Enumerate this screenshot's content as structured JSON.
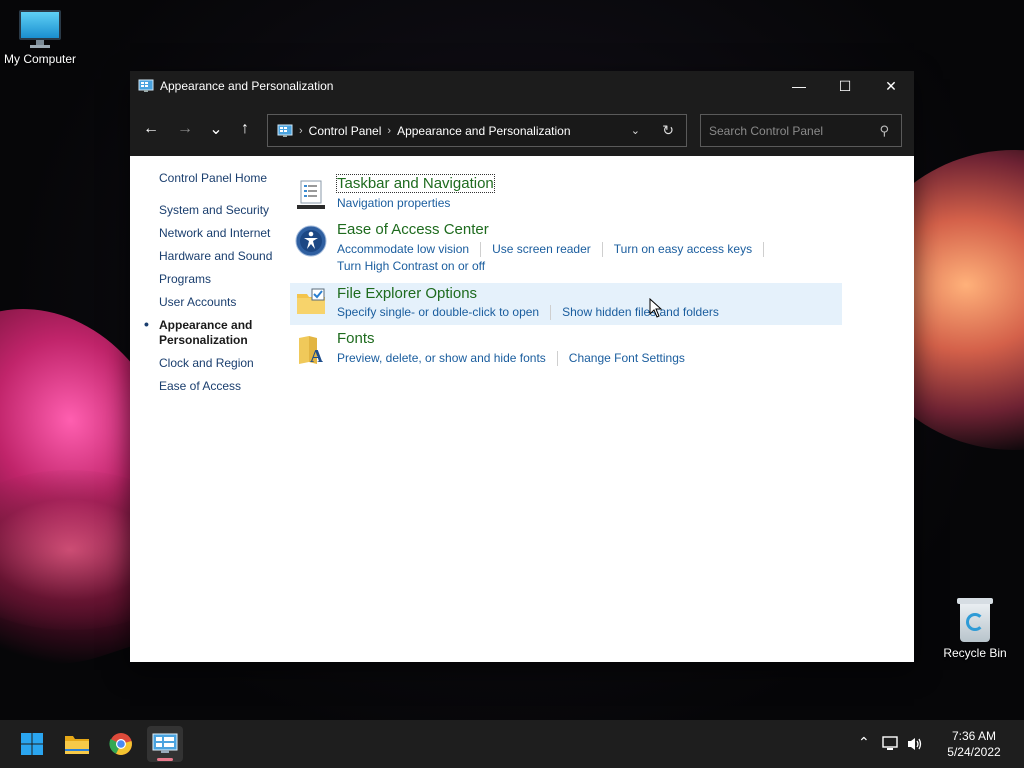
{
  "desktop": {
    "icons": [
      {
        "label": "My Computer",
        "icon": "monitor-icon"
      },
      {
        "label": "Recycle Bin",
        "icon": "recycle-bin-icon"
      }
    ]
  },
  "window": {
    "title": "Appearance and Personalization",
    "controls": {
      "minimize": "—",
      "maximize": "☐",
      "close": "✕"
    }
  },
  "navbar": {
    "back": "←",
    "forward": "→",
    "recent": "⌄",
    "up": "↑",
    "breadcrumb": [
      "Control Panel",
      "Appearance and Personalization"
    ],
    "search_placeholder": "Search Control Panel"
  },
  "leftnav": {
    "home": "Control Panel Home",
    "items": [
      "System and Security",
      "Network and Internet",
      "Hardware and Sound",
      "Programs",
      "User Accounts",
      "Appearance and Personalization",
      "Clock and Region",
      "Ease of Access"
    ],
    "active_index": 5
  },
  "categories": [
    {
      "title": "Taskbar and Navigation",
      "icon": "taskbar-icon",
      "links": [
        "Navigation properties"
      ]
    },
    {
      "title": "Ease of Access Center",
      "icon": "ease-of-access-icon",
      "links": [
        "Accommodate low vision",
        "Use screen reader",
        "Turn on easy access keys",
        "Turn High Contrast on or off"
      ]
    },
    {
      "title": "File Explorer Options",
      "icon": "folder-options-icon",
      "links": [
        "Specify single- or double-click to open",
        "Show hidden files and folders"
      ]
    },
    {
      "title": "Fonts",
      "icon": "fonts-icon",
      "links": [
        "Preview, delete, or show and hide fonts",
        "Change Font Settings"
      ]
    }
  ],
  "taskbar": {
    "apps": [
      "start-icon",
      "file-explorer-icon",
      "chrome-icon",
      "control-panel-icon"
    ],
    "clock": {
      "time": "7:36 AM",
      "date": "5/24/2022"
    }
  },
  "colors": {
    "titlebar": "#1c1c1c",
    "link": "#1a5d9e",
    "category_title": "#1e6b1e",
    "hover_row": "#e5f1fb",
    "taskbar": "#1e1e1e"
  }
}
